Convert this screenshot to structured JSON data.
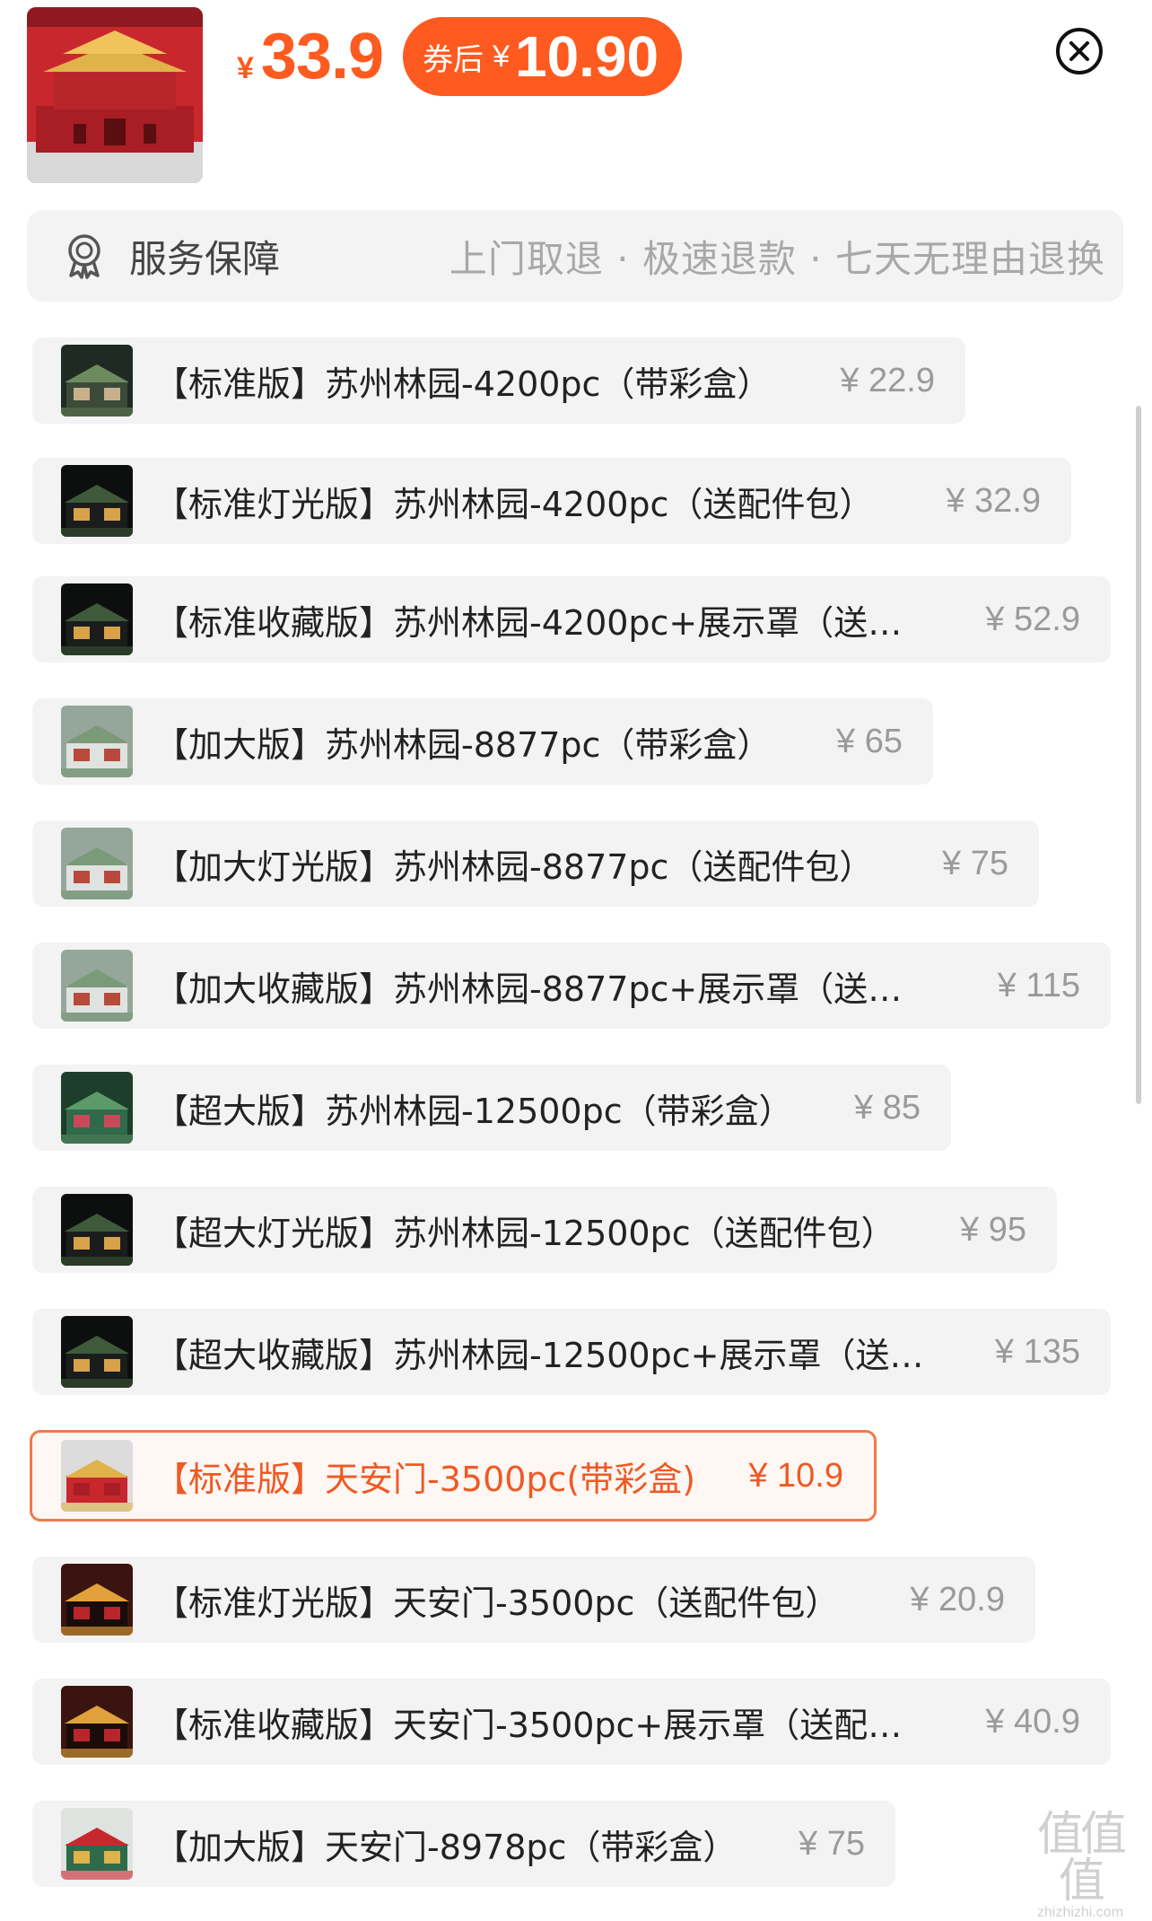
{
  "header": {
    "price_symbol": "¥",
    "price": "33.9",
    "coupon_label": "券后",
    "coupon_symbol": "¥",
    "coupon_price": "10.90",
    "accent_color": "#ff5a1f",
    "close_icon": "close-circle-icon"
  },
  "service": {
    "icon": "badge-ribbon-icon",
    "label": "服务保障",
    "description": "上门取退 · 极速退款 · 七天无理由退换"
  },
  "options": [
    {
      "name": "【标准版】苏州林园-4200pc（带彩盒）",
      "price": "¥ 22.9",
      "selected": false,
      "thumb": "garden"
    },
    {
      "name": "【标准灯光版】苏州林园-4200pc（送配件包）",
      "price": "¥ 32.9",
      "selected": false,
      "thumb": "garden-night"
    },
    {
      "name": "【标准收藏版】苏州林园-4200pc+展示罩（送…",
      "price": "¥ 52.9",
      "selected": false,
      "thumb": "garden-night"
    },
    {
      "name": "【加大版】苏州林园-8877pc（带彩盒）",
      "price": "¥ 65",
      "selected": false,
      "thumb": "garden-light"
    },
    {
      "name": "【加大灯光版】苏州林园-8877pc（送配件包）",
      "price": "¥ 75",
      "selected": false,
      "thumb": "garden-light"
    },
    {
      "name": "【加大收藏版】苏州林园-8877pc+展示罩（送…",
      "price": "¥ 115",
      "selected": false,
      "thumb": "garden-light"
    },
    {
      "name": "【超大版】苏州林园-12500pc（带彩盒）",
      "price": "¥ 85",
      "selected": false,
      "thumb": "garden-green"
    },
    {
      "name": "【超大灯光版】苏州林园-12500pc（送配件包）",
      "price": "¥ 95",
      "selected": false,
      "thumb": "garden-night"
    },
    {
      "name": "【超大收藏版】苏州林园-12500pc+展示罩（送…",
      "price": "¥ 135",
      "selected": false,
      "thumb": "garden-night"
    },
    {
      "name": "【标准版】天安门-3500pc(带彩盒)",
      "price": "¥ 10.9",
      "selected": true,
      "thumb": "tiananmen"
    },
    {
      "name": "【标准灯光版】天安门-3500pc（送配件包）",
      "price": "¥ 20.9",
      "selected": false,
      "thumb": "tiananmen-night"
    },
    {
      "name": "【标准收藏版】天安门-3500pc+展示罩（送配…",
      "price": "¥ 40.9",
      "selected": false,
      "thumb": "tiananmen-night"
    },
    {
      "name": "【加大版】天安门-8978pc（带彩盒）",
      "price": "¥ 75",
      "selected": false,
      "thumb": "tiananmen-green"
    }
  ],
  "colors": {
    "selected_text": "#ee5a24",
    "selected_border": "#f07a4c",
    "option_bg": "#f3f3f3",
    "price_gray": "#9a9a9a"
  },
  "watermark": {
    "big": "值值值",
    "small": "zhizhizhi.com"
  }
}
